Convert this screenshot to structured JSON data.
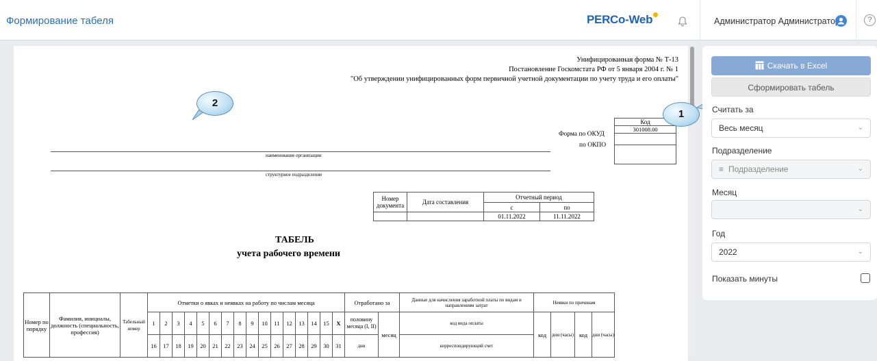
{
  "header": {
    "title": "Формирование табеля",
    "logo": "PERCo-Web",
    "user": "Администратор Администратор",
    "help": "?"
  },
  "doc": {
    "form_line1": "Унифицированная форма № Т-13",
    "form_line2": "Постановление Госкомстата РФ от 5 января 2004 г. № 1",
    "form_line3": "\"Об утверждении унифицированных форм первичной учетной документации по учету труда и его оплаты\"",
    "kod_label": "Код",
    "okud_label": "Форма по ОКУД",
    "okud_code": "301008.00",
    "okpo_label": "по ОКПО",
    "org_caption": "наименование организации",
    "dept_caption": "структурное подразделение",
    "doc_num": "Номер документа",
    "doc_date": "Дата составления",
    "period": "Отчетный период",
    "from": "с",
    "to": "по",
    "from_date": "01.11.2022",
    "to_date": "11.11.2022",
    "title1": "ТАБЕЛЬ",
    "title2": "учета рабочего времени",
    "col_num": "Номер по порядку",
    "col_fio": "Фамилия, инициалы, должность (специальность, профессия)",
    "col_tab": "Табельный номер",
    "col_marks": "Отметки о явках и неявках на работу по числам месяца",
    "days1": [
      "1",
      "2",
      "3",
      "4",
      "5",
      "6",
      "7",
      "8",
      "9",
      "10",
      "11",
      "12",
      "13",
      "14",
      "15",
      "X"
    ],
    "days2": [
      "16",
      "17",
      "18",
      "19",
      "20",
      "21",
      "22",
      "23",
      "24",
      "25",
      "26",
      "27",
      "28",
      "29",
      "30",
      "31"
    ],
    "col_worked": "Отработано за",
    "half_month": "половину месяца (I, II)",
    "month": "месяц",
    "days_lbl": "дни",
    "col_salary": "Данные для начисления заработной платы по видам и направлениям затрат",
    "pay_code": "код вида оплаты",
    "corr_acc": "корреспондирующий счет",
    "col_absence": "Неявки по причинам",
    "code": "код",
    "days_hours": "дни (часы)"
  },
  "callouts": {
    "one": "1",
    "two": "2"
  },
  "panel": {
    "excel_btn": "Скачать в Excel",
    "form_btn": "Сформировать табель",
    "count_label": "Считать за",
    "count_value": "Весь месяц",
    "dept_label": "Подразделение",
    "dept_placeholder": "Подразделение",
    "month_label": "Месяц",
    "month_value": "",
    "year_label": "Год",
    "year_value": "2022",
    "minutes_label": "Показать минуты",
    "minutes_checked": false
  }
}
